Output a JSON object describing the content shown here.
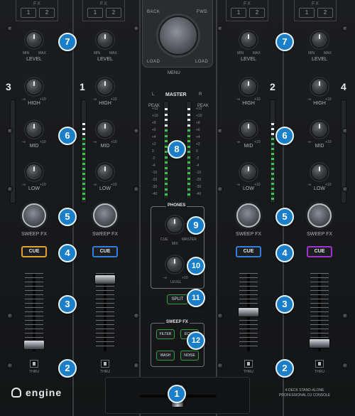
{
  "fx": {
    "label": "FX",
    "btn1": "1",
    "btn2": "2"
  },
  "nav": {
    "back": "BACK",
    "fwd": "FWD",
    "load_left": "LOAD",
    "load_right": "LOAD",
    "menu": "MENU",
    "menu_btn": "MENU"
  },
  "knob_labels": {
    "level": "LEVEL",
    "high": "HIGH",
    "mid": "MID",
    "low": "LOW",
    "sweep": "SWEEP FX",
    "min": "MIN",
    "max": "MAX",
    "minus": "-∞",
    "plus": "+10"
  },
  "decks": {
    "d3": "3",
    "d1": "1",
    "d2": "2",
    "d4": "4"
  },
  "cue": "CUE",
  "thru": "THRU",
  "thru_scale": "L —— R",
  "master": {
    "title": "MASTER",
    "left": "L",
    "right": "R",
    "peak_l": "PEAK",
    "peak_r": "PEAK",
    "scale": [
      "+12",
      "+10",
      "+8",
      "+6",
      "+4",
      "+2",
      "0",
      "-2",
      "-4",
      "-10",
      "-20",
      "-30",
      "-40"
    ]
  },
  "phones": {
    "title": "PHONES",
    "cue": "CUE",
    "master": "MASTER",
    "mix": "MIX",
    "level": "LEVEL",
    "minus": "-∞",
    "plus": "+10",
    "split": "SPLIT"
  },
  "sweep_fx": {
    "title": "SWEEP FX",
    "filter": "FILTER",
    "echo": "ECHO",
    "wash": "WASH",
    "noise": "NOISE"
  },
  "badges": {
    "b1": "1",
    "b2": "2",
    "b3": "3",
    "b4": "4",
    "b5": "5",
    "b6": "6",
    "b7": "7",
    "b8": "8",
    "b9": "9",
    "b10": "10",
    "b11": "11",
    "b12": "12"
  },
  "brand": {
    "logo": "engine",
    "tagline1": "4-DECK STAND-ALONE",
    "tagline2": "PROFESSIONAL DJ CONSOLE"
  },
  "colors": {
    "badge": "#1a7fc8",
    "cue_deck3": "#e0a030",
    "cue_deck1": "#2f7fe0",
    "cue_deck2": "#2f7fe0",
    "cue_deck4": "#a030d0",
    "meter_green": "#3ec04a",
    "sfx_green": "#3c9b45"
  }
}
